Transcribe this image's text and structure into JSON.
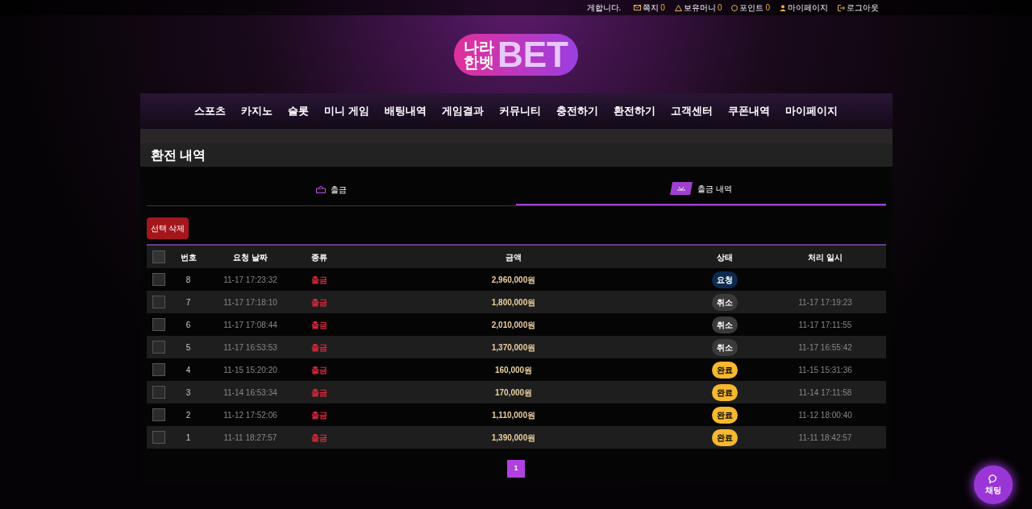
{
  "top_bar": {
    "greeting": "게합니다.",
    "items": [
      {
        "kind": "mail",
        "label": "쪽지",
        "count": "0"
      },
      {
        "kind": "money",
        "label": "보유머니",
        "count": "0"
      },
      {
        "kind": "point",
        "label": "포인트",
        "count": "0"
      },
      {
        "kind": "user",
        "label": "마이페이지"
      },
      {
        "kind": "logout",
        "label": "로그아웃"
      }
    ]
  },
  "logo": {
    "line_1": "나라",
    "line_2": "한벳",
    "mark": "BET"
  },
  "nav": [
    "스포츠",
    "카지노",
    "슬롯",
    "미니 게임",
    "배팅내역",
    "게임결과",
    "커뮤니티",
    "충전하기",
    "환전하기",
    "고객센터",
    "쿠폰내역",
    "마이페이지"
  ],
  "page_title": "환전 내역",
  "tabs": [
    {
      "label": "출금",
      "selected": false
    },
    {
      "label": "출금 내역",
      "selected": true
    }
  ],
  "delete_button": "선택 삭제",
  "table": {
    "select_all_checked": false,
    "columns": [
      "번호",
      "요청 날짜",
      "종류",
      "금액",
      "상태",
      "처리 일시"
    ],
    "rows": [
      {
        "no": "8",
        "requested": "11-17 17:23:32",
        "type": "출금",
        "amount": "2,960,000원",
        "status": "요청",
        "color": "#0d2a4e",
        "processed": "",
        "checked": false
      },
      {
        "no": "7",
        "requested": "11-17 17:18:10",
        "type": "출금",
        "amount": "1,800,000원",
        "status": "취소",
        "color": "#3a3a3a",
        "processed": "11-17 17:19:23",
        "checked": false
      },
      {
        "no": "6",
        "requested": "11-17 17:08:44",
        "type": "출금",
        "amount": "2,010,000원",
        "status": "취소",
        "color": "#3a3a3a",
        "processed": "11-17 17:11:55",
        "checked": false
      },
      {
        "no": "5",
        "requested": "11-17 16:53:53",
        "type": "출금",
        "amount": "1,370,000원",
        "status": "취소",
        "color": "#3a3a3a",
        "processed": "11-17 16:55:42",
        "checked": false
      },
      {
        "no": "4",
        "requested": "11-15 15:20:20",
        "type": "출금",
        "amount": "160,000원",
        "status": "완료",
        "color": "#f5b82e",
        "processed": "11-15 15:31:36",
        "checked": false
      },
      {
        "no": "3",
        "requested": "11-14 16:53:34",
        "type": "출금",
        "amount": "170,000원",
        "status": "완료",
        "color": "#f5b82e",
        "processed": "11-14 17:11:58",
        "checked": false
      },
      {
        "no": "2",
        "requested": "11-12 17:52:06",
        "type": "출금",
        "amount": "1,110,000원",
        "status": "완료",
        "color": "#f5b82e",
        "processed": "11-12 18:00:40",
        "checked": false
      },
      {
        "no": "1",
        "requested": "11-11 18:27:57",
        "type": "출금",
        "amount": "1,390,000원",
        "status": "완료",
        "color": "#f5b82e",
        "processed": "11-11 18:42:57",
        "checked": false
      }
    ]
  },
  "pagination": [
    {
      "label": "1",
      "selected": true
    }
  ],
  "chat_button": "채팅"
}
